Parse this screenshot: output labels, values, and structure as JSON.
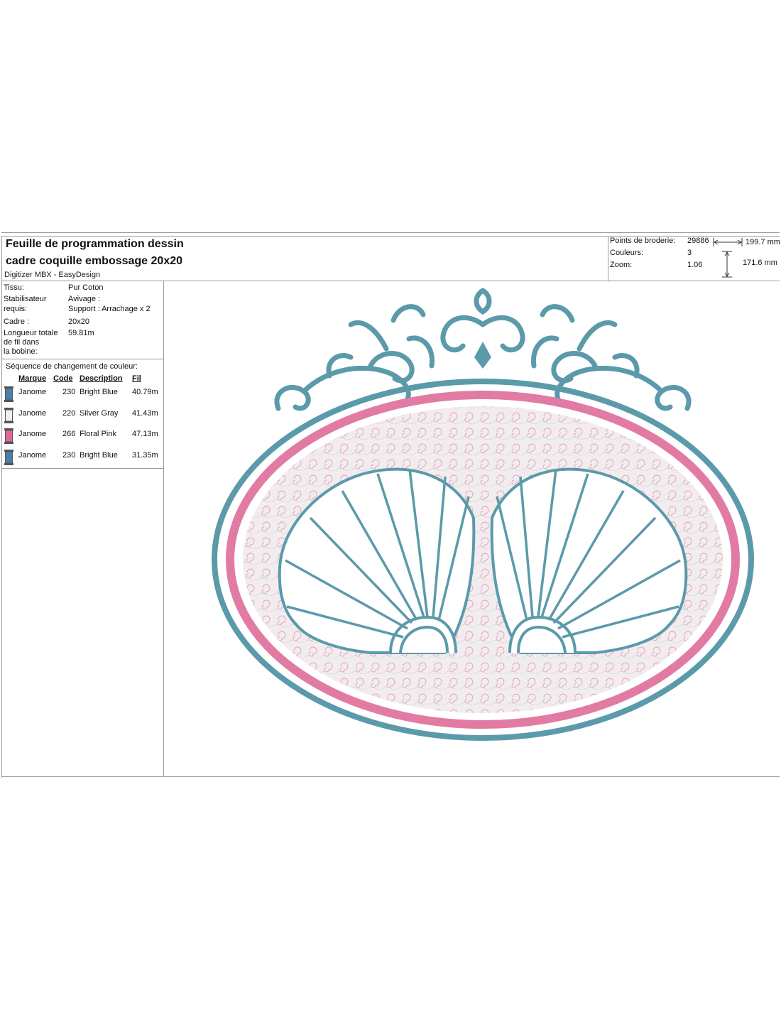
{
  "sheet": {
    "title_line1": "Feuille de programmation dessin",
    "title_line2": "cadre coquille embossage 20x20",
    "software": "Digitizer MBX - EasyDesign"
  },
  "stats": {
    "points_label": "Points de broderie:",
    "points_value": "29886",
    "colors_label": "Couleurs:",
    "colors_value": "3",
    "zoom_label": "Zoom:",
    "zoom_value": "1.06",
    "width": "199.7 mm",
    "height": "171.6 mm"
  },
  "info": {
    "tissu_label": "Tissu:",
    "tissu_value": "Pur Coton",
    "stab_label_1": "Stabilisateur",
    "stab_label_2": "requis:",
    "stab_value_1": "Avivage :",
    "stab_value_2": "Support : Arrachage x 2",
    "cadre_label": "Cadre :",
    "cadre_value": "20x20",
    "length_label_1": "Longueur totale",
    "length_label_2": "de fil dans",
    "length_label_3": "la bobine:",
    "length_value": "59.81m"
  },
  "sequence": {
    "heading": "Séquence de changement de couleur:",
    "headers": {
      "brand": "Marque",
      "code": "Code",
      "description": "Description",
      "fil": "Fil"
    },
    "rows": [
      {
        "brand": "Janome",
        "code": "230",
        "description": "Bright Blue",
        "fil": "40.79m",
        "color": "#4d7ea6"
      },
      {
        "brand": "Janome",
        "code": "220",
        "description": "Silver Gray",
        "fil": "41.43m",
        "color": "#f0f0f0"
      },
      {
        "brand": "Janome",
        "code": "266",
        "description": "Floral Pink",
        "fil": "47.13m",
        "color": "#e0669a"
      },
      {
        "brand": "Janome",
        "code": "230",
        "description": "Bright Blue",
        "fil": "31.35m",
        "color": "#4d7ea6"
      }
    ]
  },
  "design_colors": {
    "blue": "#5b9aaa",
    "pink": "#e27ba3",
    "fill": "#f1e7ea"
  }
}
